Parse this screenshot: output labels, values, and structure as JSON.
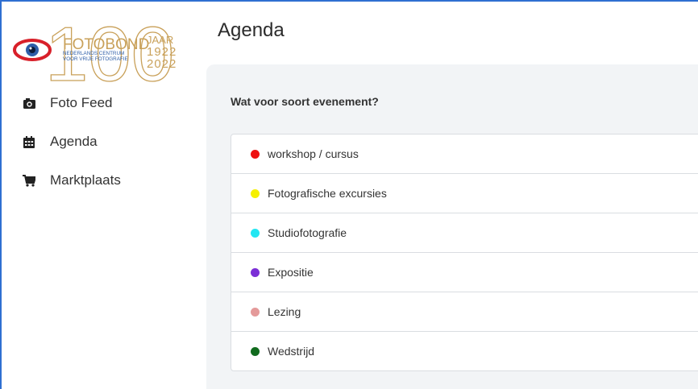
{
  "header": {
    "title": "Agenda"
  },
  "logo": {
    "word": "FOTOBOND",
    "jaar": "JAAR",
    "sub1": "NEDERLANDS CENTRUM",
    "sub2": "VOOR VRIJE FOTOGRAFIE",
    "year_start": "1922",
    "year_end": "2022",
    "number": "100"
  },
  "sidebar": {
    "items": [
      {
        "label": "Foto Feed",
        "icon": "camera-icon"
      },
      {
        "label": "Agenda",
        "icon": "calendar-icon"
      },
      {
        "label": "Marktplaats",
        "icon": "cart-icon"
      }
    ]
  },
  "main": {
    "question": "Wat voor soort evenement?",
    "event_types": [
      {
        "label": "workshop / cursus",
        "color": "#ee1111"
      },
      {
        "label": "Fotografische excursies",
        "color": "#f5f000"
      },
      {
        "label": "Studiofotografie",
        "color": "#22e6f2"
      },
      {
        "label": "Expositie",
        "color": "#7b2fd6"
      },
      {
        "label": "Lezing",
        "color": "#e49a9a"
      },
      {
        "label": "Wedstrijd",
        "color": "#116b1e"
      }
    ]
  },
  "colors": {
    "frame": "#2f6fd1",
    "logo_gold": "#c9a15a",
    "logo_blue": "#2e5ea8",
    "logo_red": "#d8202a"
  }
}
